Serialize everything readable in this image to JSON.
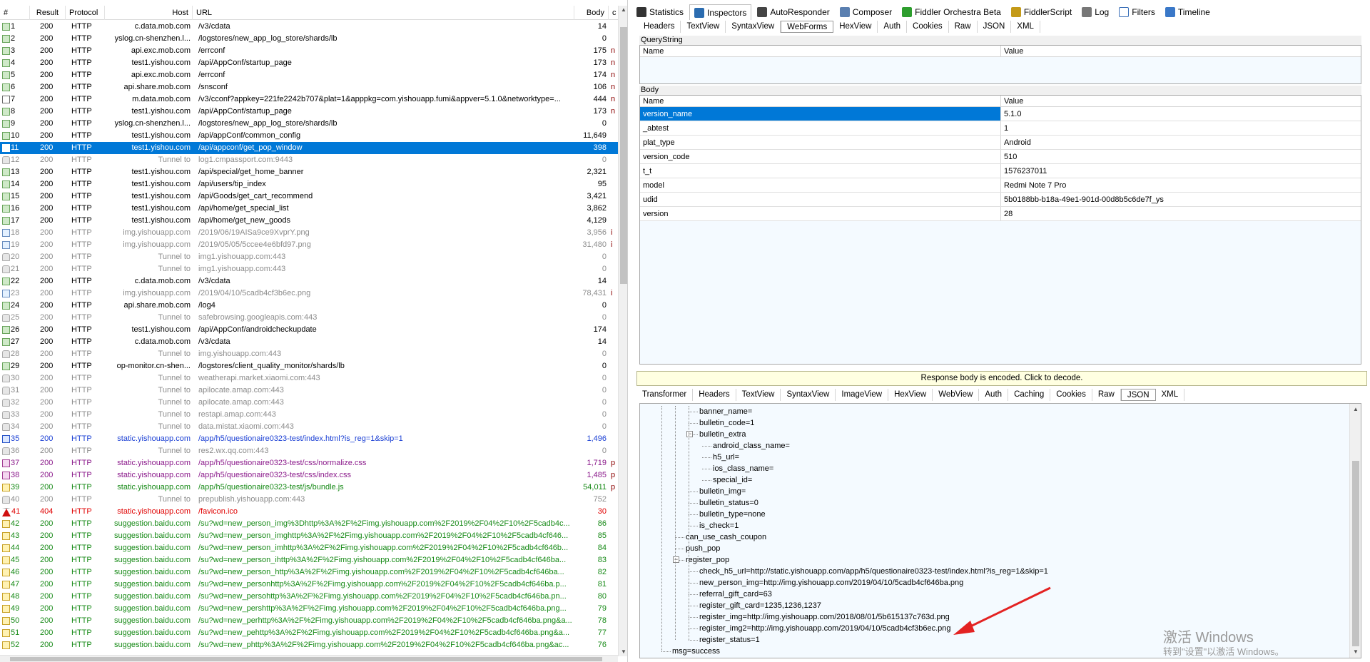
{
  "columns": {
    "num": "#",
    "result": "Result",
    "protocol": "Protocol",
    "host": "Host",
    "url": "URL",
    "body": "Body",
    "ext": "c"
  },
  "sessions": [
    {
      "num": "1",
      "result": "200",
      "protocol": "HTTP",
      "host": "c.data.mob.com",
      "url": "/v3/cdata",
      "body": "14",
      "ext": "",
      "icon": "green",
      "color": "#000000"
    },
    {
      "num": "2",
      "result": "200",
      "protocol": "HTTP",
      "host": "yslog.cn-shenzhen.l...",
      "url": "/logstores/new_app_log_store/shards/lb",
      "body": "0",
      "ext": "",
      "icon": "green",
      "color": "#000000"
    },
    {
      "num": "3",
      "result": "200",
      "protocol": "HTTP",
      "host": "api.exc.mob.com",
      "url": "/errconf",
      "body": "175",
      "ext": "n",
      "icon": "green",
      "color": "#000000"
    },
    {
      "num": "4",
      "result": "200",
      "protocol": "HTTP",
      "host": "test1.yishou.com",
      "url": "/api/AppConf/startup_page",
      "body": "173",
      "ext": "n",
      "icon": "green",
      "color": "#000000"
    },
    {
      "num": "5",
      "result": "200",
      "protocol": "HTTP",
      "host": "api.exc.mob.com",
      "url": "/errconf",
      "body": "174",
      "ext": "n",
      "icon": "green",
      "color": "#000000"
    },
    {
      "num": "6",
      "result": "200",
      "protocol": "HTTP",
      "host": "api.share.mob.com",
      "url": "/snsconf",
      "body": "106",
      "ext": "n",
      "icon": "green",
      "color": "#000000"
    },
    {
      "num": "7",
      "result": "200",
      "protocol": "HTTP",
      "host": "m.data.mob.com",
      "url": "/v3/cconf?appkey=221fe2242b707&plat=1&apppkg=com.yishouapp.fumi&appver=5.1.0&networktype=...",
      "body": "444",
      "ext": "n",
      "icon": "doc",
      "color": "#000000"
    },
    {
      "num": "8",
      "result": "200",
      "protocol": "HTTP",
      "host": "test1.yishou.com",
      "url": "/api/AppConf/startup_page",
      "body": "173",
      "ext": "n",
      "icon": "green",
      "color": "#000000"
    },
    {
      "num": "9",
      "result": "200",
      "protocol": "HTTP",
      "host": "yslog.cn-shenzhen.l...",
      "url": "/logstores/new_app_log_store/shards/lb",
      "body": "0",
      "ext": "",
      "icon": "green",
      "color": "#000000"
    },
    {
      "num": "10",
      "result": "200",
      "protocol": "HTTP",
      "host": "test1.yishou.com",
      "url": "/api/appConf/common_config",
      "body": "11,649",
      "ext": "",
      "icon": "green",
      "color": "#000000"
    },
    {
      "num": "11",
      "result": "200",
      "protocol": "HTTP",
      "host": "test1.yishou.com",
      "url": "/api/appconf/get_pop_window",
      "body": "398",
      "ext": "",
      "icon": "sel",
      "color": "#ffffff",
      "selected": true
    },
    {
      "num": "12",
      "result": "200",
      "protocol": "HTTP",
      "host": "Tunnel to",
      "url": "log1.cmpassport.com:9443",
      "body": "0",
      "ext": "",
      "icon": "lock",
      "color": "#8c8c8c"
    },
    {
      "num": "13",
      "result": "200",
      "protocol": "HTTP",
      "host": "test1.yishou.com",
      "url": "/api/special/get_home_banner",
      "body": "2,321",
      "ext": "",
      "icon": "green",
      "color": "#000000"
    },
    {
      "num": "14",
      "result": "200",
      "protocol": "HTTP",
      "host": "test1.yishou.com",
      "url": "/api/users/tip_index",
      "body": "95",
      "ext": "",
      "icon": "green",
      "color": "#000000"
    },
    {
      "num": "15",
      "result": "200",
      "protocol": "HTTP",
      "host": "test1.yishou.com",
      "url": "/api/Goods/get_cart_recommend",
      "body": "3,421",
      "ext": "",
      "icon": "green",
      "color": "#000000"
    },
    {
      "num": "16",
      "result": "200",
      "protocol": "HTTP",
      "host": "test1.yishou.com",
      "url": "/api/home/get_special_list",
      "body": "3,862",
      "ext": "",
      "icon": "green",
      "color": "#000000"
    },
    {
      "num": "17",
      "result": "200",
      "protocol": "HTTP",
      "host": "test1.yishou.com",
      "url": "/api/home/get_new_goods",
      "body": "4,129",
      "ext": "",
      "icon": "green",
      "color": "#000000"
    },
    {
      "num": "18",
      "result": "200",
      "protocol": "HTTP",
      "host": "img.yishouapp.com",
      "url": "/2019/06/19AISa9ce9XvprY.png",
      "body": "3,956",
      "ext": "i",
      "icon": "img",
      "color": "#8c8c8c"
    },
    {
      "num": "19",
      "result": "200",
      "protocol": "HTTP",
      "host": "img.yishouapp.com",
      "url": "/2019/05/05/5ccee4e6bfd97.png",
      "body": "31,480",
      "ext": "i",
      "icon": "img",
      "color": "#8c8c8c"
    },
    {
      "num": "20",
      "result": "200",
      "protocol": "HTTP",
      "host": "Tunnel to",
      "url": "img1.yishouapp.com:443",
      "body": "0",
      "ext": "",
      "icon": "lock",
      "color": "#8c8c8c"
    },
    {
      "num": "21",
      "result": "200",
      "protocol": "HTTP",
      "host": "Tunnel to",
      "url": "img1.yishouapp.com:443",
      "body": "0",
      "ext": "",
      "icon": "lock",
      "color": "#8c8c8c"
    },
    {
      "num": "22",
      "result": "200",
      "protocol": "HTTP",
      "host": "c.data.mob.com",
      "url": "/v3/cdata",
      "body": "14",
      "ext": "",
      "icon": "green",
      "color": "#000000"
    },
    {
      "num": "23",
      "result": "200",
      "protocol": "HTTP",
      "host": "img.yishouapp.com",
      "url": "/2019/04/10/5cadb4cf3b6ec.png",
      "body": "78,431",
      "ext": "i",
      "icon": "img",
      "color": "#8c8c8c"
    },
    {
      "num": "24",
      "result": "200",
      "protocol": "HTTP",
      "host": "api.share.mob.com",
      "url": "/log4",
      "body": "0",
      "ext": "",
      "icon": "green",
      "color": "#000000"
    },
    {
      "num": "25",
      "result": "200",
      "protocol": "HTTP",
      "host": "Tunnel to",
      "url": "safebrowsing.googleapis.com:443",
      "body": "0",
      "ext": "",
      "icon": "lock",
      "color": "#8c8c8c"
    },
    {
      "num": "26",
      "result": "200",
      "protocol": "HTTP",
      "host": "test1.yishou.com",
      "url": "/api/AppConf/androidcheckupdate",
      "body": "174",
      "ext": "",
      "icon": "green",
      "color": "#000000"
    },
    {
      "num": "27",
      "result": "200",
      "protocol": "HTTP",
      "host": "c.data.mob.com",
      "url": "/v3/cdata",
      "body": "14",
      "ext": "",
      "icon": "green",
      "color": "#000000"
    },
    {
      "num": "28",
      "result": "200",
      "protocol": "HTTP",
      "host": "Tunnel to",
      "url": "img.yishouapp.com:443",
      "body": "0",
      "ext": "",
      "icon": "lock",
      "color": "#8c8c8c"
    },
    {
      "num": "29",
      "result": "200",
      "protocol": "HTTP",
      "host": "op-monitor.cn-shen...",
      "url": "/logstores/client_quality_monitor/shards/lb",
      "body": "0",
      "ext": "",
      "icon": "green",
      "color": "#000000"
    },
    {
      "num": "30",
      "result": "200",
      "protocol": "HTTP",
      "host": "Tunnel to",
      "url": "weatherapi.market.xiaomi.com:443",
      "body": "0",
      "ext": "",
      "icon": "lock",
      "color": "#8c8c8c"
    },
    {
      "num": "31",
      "result": "200",
      "protocol": "HTTP",
      "host": "Tunnel to",
      "url": "apilocate.amap.com:443",
      "body": "0",
      "ext": "",
      "icon": "lock",
      "color": "#8c8c8c"
    },
    {
      "num": "32",
      "result": "200",
      "protocol": "HTTP",
      "host": "Tunnel to",
      "url": "apilocate.amap.com:443",
      "body": "0",
      "ext": "",
      "icon": "lock",
      "color": "#8c8c8c"
    },
    {
      "num": "33",
      "result": "200",
      "protocol": "HTTP",
      "host": "Tunnel to",
      "url": "restapi.amap.com:443",
      "body": "0",
      "ext": "",
      "icon": "lock",
      "color": "#8c8c8c"
    },
    {
      "num": "34",
      "result": "200",
      "protocol": "HTTP",
      "host": "Tunnel to",
      "url": "data.mistat.xiaomi.com:443",
      "body": "0",
      "ext": "",
      "icon": "lock",
      "color": "#8c8c8c"
    },
    {
      "num": "35",
      "result": "200",
      "protocol": "HTTP",
      "host": "static.yishouapp.com",
      "url": "/app/h5/questionaire0323-test/index.html?is_reg=1&skip=1",
      "body": "1,496",
      "ext": "",
      "icon": "html",
      "color": "#1a3fd4"
    },
    {
      "num": "36",
      "result": "200",
      "protocol": "HTTP",
      "host": "Tunnel to",
      "url": "res2.wx.qq.com:443",
      "body": "0",
      "ext": "",
      "icon": "lock",
      "color": "#8c8c8c"
    },
    {
      "num": "37",
      "result": "200",
      "protocol": "HTTP",
      "host": "static.yishouapp.com",
      "url": "/app/h5/questionaire0323-test/css/normalize.css",
      "body": "1,719",
      "ext": "p",
      "icon": "css",
      "color": "#8b1a8b"
    },
    {
      "num": "38",
      "result": "200",
      "protocol": "HTTP",
      "host": "static.yishouapp.com",
      "url": "/app/h5/questionaire0323-test/css/index.css",
      "body": "1,485",
      "ext": "p",
      "icon": "css",
      "color": "#8b1a8b"
    },
    {
      "num": "39",
      "result": "200",
      "protocol": "HTTP",
      "host": "static.yishouapp.com",
      "url": "/app/h5/questionaire0323-test/js/bundle.js",
      "body": "54,011",
      "ext": "p",
      "icon": "js",
      "color": "#178a17"
    },
    {
      "num": "40",
      "result": "200",
      "protocol": "HTTP",
      "host": "Tunnel to",
      "url": "prepublish.yishouapp.com:443",
      "body": "752",
      "ext": "",
      "icon": "lock",
      "color": "#8c8c8c"
    },
    {
      "num": "41",
      "result": "404",
      "protocol": "HTTP",
      "host": "static.yishouapp.com",
      "url": "/favicon.ico",
      "body": "30",
      "ext": "",
      "icon": "warn",
      "color": "#e00000"
    },
    {
      "num": "42",
      "result": "200",
      "protocol": "HTTP",
      "host": "suggestion.baidu.com",
      "url": "/su?wd=new_person_img%3Dhttp%3A%2F%2Fimg.yishouapp.com%2F2019%2F04%2F10%2F5cadb4c...",
      "body": "86",
      "ext": "",
      "icon": "js",
      "color": "#178a17"
    },
    {
      "num": "43",
      "result": "200",
      "protocol": "HTTP",
      "host": "suggestion.baidu.com",
      "url": "/su?wd=new_person_imghttp%3A%2F%2Fimg.yishouapp.com%2F2019%2F04%2F10%2F5cadb4cf646...",
      "body": "85",
      "ext": "",
      "icon": "js",
      "color": "#178a17"
    },
    {
      "num": "44",
      "result": "200",
      "protocol": "HTTP",
      "host": "suggestion.baidu.com",
      "url": "/su?wd=new_person_imhttp%3A%2F%2Fimg.yishouapp.com%2F2019%2F04%2F10%2F5cadb4cf646b...",
      "body": "84",
      "ext": "",
      "icon": "js",
      "color": "#178a17"
    },
    {
      "num": "45",
      "result": "200",
      "protocol": "HTTP",
      "host": "suggestion.baidu.com",
      "url": "/su?wd=new_person_ihttp%3A%2F%2Fimg.yishouapp.com%2F2019%2F04%2F10%2F5cadb4cf646ba...",
      "body": "83",
      "ext": "",
      "icon": "js",
      "color": "#178a17"
    },
    {
      "num": "46",
      "result": "200",
      "protocol": "HTTP",
      "host": "suggestion.baidu.com",
      "url": "/su?wd=new_person_http%3A%2F%2Fimg.yishouapp.com%2F2019%2F04%2F10%2F5cadb4cf646ba...",
      "body": "82",
      "ext": "",
      "icon": "js",
      "color": "#178a17"
    },
    {
      "num": "47",
      "result": "200",
      "protocol": "HTTP",
      "host": "suggestion.baidu.com",
      "url": "/su?wd=new_personhttp%3A%2F%2Fimg.yishouapp.com%2F2019%2F04%2F10%2F5cadb4cf646ba.p...",
      "body": "81",
      "ext": "",
      "icon": "js",
      "color": "#178a17"
    },
    {
      "num": "48",
      "result": "200",
      "protocol": "HTTP",
      "host": "suggestion.baidu.com",
      "url": "/su?wd=new_persohttp%3A%2F%2Fimg.yishouapp.com%2F2019%2F04%2F10%2F5cadb4cf646ba.pn...",
      "body": "80",
      "ext": "",
      "icon": "js",
      "color": "#178a17"
    },
    {
      "num": "49",
      "result": "200",
      "protocol": "HTTP",
      "host": "suggestion.baidu.com",
      "url": "/su?wd=new_pershttp%3A%2F%2Fimg.yishouapp.com%2F2019%2F04%2F10%2F5cadb4cf646ba.png...",
      "body": "79",
      "ext": "",
      "icon": "js",
      "color": "#178a17"
    },
    {
      "num": "50",
      "result": "200",
      "protocol": "HTTP",
      "host": "suggestion.baidu.com",
      "url": "/su?wd=new_perhttp%3A%2F%2Fimg.yishouapp.com%2F2019%2F04%2F10%2F5cadb4cf646ba.png&a...",
      "body": "78",
      "ext": "",
      "icon": "js",
      "color": "#178a17"
    },
    {
      "num": "51",
      "result": "200",
      "protocol": "HTTP",
      "host": "suggestion.baidu.com",
      "url": "/su?wd=new_pehttp%3A%2F%2Fimg.yishouapp.com%2F2019%2F04%2F10%2F5cadb4cf646ba.png&a...",
      "body": "77",
      "ext": "",
      "icon": "js",
      "color": "#178a17"
    },
    {
      "num": "52",
      "result": "200",
      "protocol": "HTTP",
      "host": "suggestion.baidu.com",
      "url": "/su?wd=new_phttp%3A%2F%2Fimg.yishouapp.com%2F2019%2F04%2F10%2F5cadb4cf646ba.png&ac...",
      "body": "76",
      "ext": "",
      "icon": "js",
      "color": "#178a17"
    }
  ],
  "main_tabs": [
    {
      "label": "Statistics",
      "icon": "stopwatch-icon",
      "color": "#333333",
      "active": false
    },
    {
      "label": "Inspectors",
      "icon": "magnifier-icon",
      "color": "#2b6cb0",
      "active": true
    },
    {
      "label": "AutoResponder",
      "icon": "lightning-icon",
      "color": "#444444",
      "active": false
    },
    {
      "label": "Composer",
      "icon": "composer-icon",
      "color": "#5a7fb0",
      "active": false
    },
    {
      "label": "Fiddler Orchestra Beta",
      "icon": "fo-icon",
      "color": "#2e9e2e",
      "active": false
    },
    {
      "label": "FiddlerScript",
      "icon": "script-icon",
      "color": "#c49a18",
      "active": false
    },
    {
      "label": "Log",
      "icon": "log-icon",
      "color": "#777777",
      "active": false
    },
    {
      "label": "Filters",
      "icon": "checkbox-icon",
      "color": "#ffffff",
      "active": false
    },
    {
      "label": "Timeline",
      "icon": "timeline-icon",
      "color": "#3a78c8",
      "active": false
    }
  ],
  "request_tabs": [
    "Headers",
    "TextView",
    "SyntaxView",
    "WebForms",
    "HexView",
    "Auth",
    "Cookies",
    "Raw",
    "JSON",
    "XML"
  ],
  "request_tab_active": "WebForms",
  "querystring": {
    "title": "QueryString",
    "col_name": "Name",
    "col_value": "Value"
  },
  "body_section": {
    "title": "Body",
    "col_name": "Name",
    "col_value": "Value",
    "rows": [
      {
        "name": "version_name",
        "value": "5.1.0",
        "selected": true
      },
      {
        "name": "_abtest",
        "value": "1"
      },
      {
        "name": "plat_type",
        "value": "Android"
      },
      {
        "name": "version_code",
        "value": "510"
      },
      {
        "name": "t_t",
        "value": "1576237011"
      },
      {
        "name": "model",
        "value": "Redmi Note 7 Pro"
      },
      {
        "name": "udid",
        "value": "5b0188bb-b18a-49e1-901d-00d8b5c6de7f_ys"
      },
      {
        "name": "version",
        "value": "28"
      }
    ]
  },
  "encoded_notice": "Response body is encoded. Click to decode.",
  "response_tabs": [
    "Transformer",
    "Headers",
    "TextView",
    "SyntaxView",
    "ImageView",
    "HexView",
    "WebView",
    "Auth",
    "Caching",
    "Cookies",
    "Raw",
    "JSON",
    "XML"
  ],
  "response_tab_active": "JSON",
  "json_tree": [
    {
      "text": "banner_name=",
      "depth": 3
    },
    {
      "text": "bulletin_code=1",
      "depth": 3
    },
    {
      "text": "bulletin_extra",
      "depth": 3,
      "toggle": "-"
    },
    {
      "text": "android_class_name=",
      "depth": 4
    },
    {
      "text": "h5_url=",
      "depth": 4
    },
    {
      "text": "ios_class_name=",
      "depth": 4
    },
    {
      "text": "special_id=",
      "depth": 4
    },
    {
      "text": "bulletin_img=",
      "depth": 3
    },
    {
      "text": "bulletin_status=0",
      "depth": 3
    },
    {
      "text": "bulletin_type=none",
      "depth": 3
    },
    {
      "text": "is_check=1",
      "depth": 3
    },
    {
      "text": "can_use_cash_coupon",
      "depth": 2
    },
    {
      "text": "push_pop",
      "depth": 2
    },
    {
      "text": "register_pop",
      "depth": 2,
      "toggle": "-"
    },
    {
      "text": "check_h5_url=http://static.yishouapp.com/app/h5/questionaire0323-test/index.html?is_reg=1&skip=1",
      "depth": 3
    },
    {
      "text": "new_person_img=http://img.yishouapp.com/2019/04/10/5cadb4cf646ba.png",
      "depth": 3
    },
    {
      "text": "referral_gift_card=63",
      "depth": 3
    },
    {
      "text": "register_gift_card=1235,1236,1237",
      "depth": 3
    },
    {
      "text": "register_img=http://img.yishouapp.com/2018/08/01/5b615137c763d.png",
      "depth": 3
    },
    {
      "text": "register_img2=http://img.yishouapp.com/2019/04/10/5cadb4cf3b6ec.png",
      "depth": 3
    },
    {
      "text": "register_status=1",
      "depth": 3
    },
    {
      "text": "msg=success",
      "depth": 1
    }
  ],
  "watermark": {
    "line1": "激活 Windows",
    "line2": "转到\"设置\"以激活 Windows。"
  },
  "colors": {
    "selection": "#0078d7",
    "annotation_arrow": "#e32222",
    "notice_bg": "#ffffe1",
    "tree_bg": "#f4faff"
  }
}
